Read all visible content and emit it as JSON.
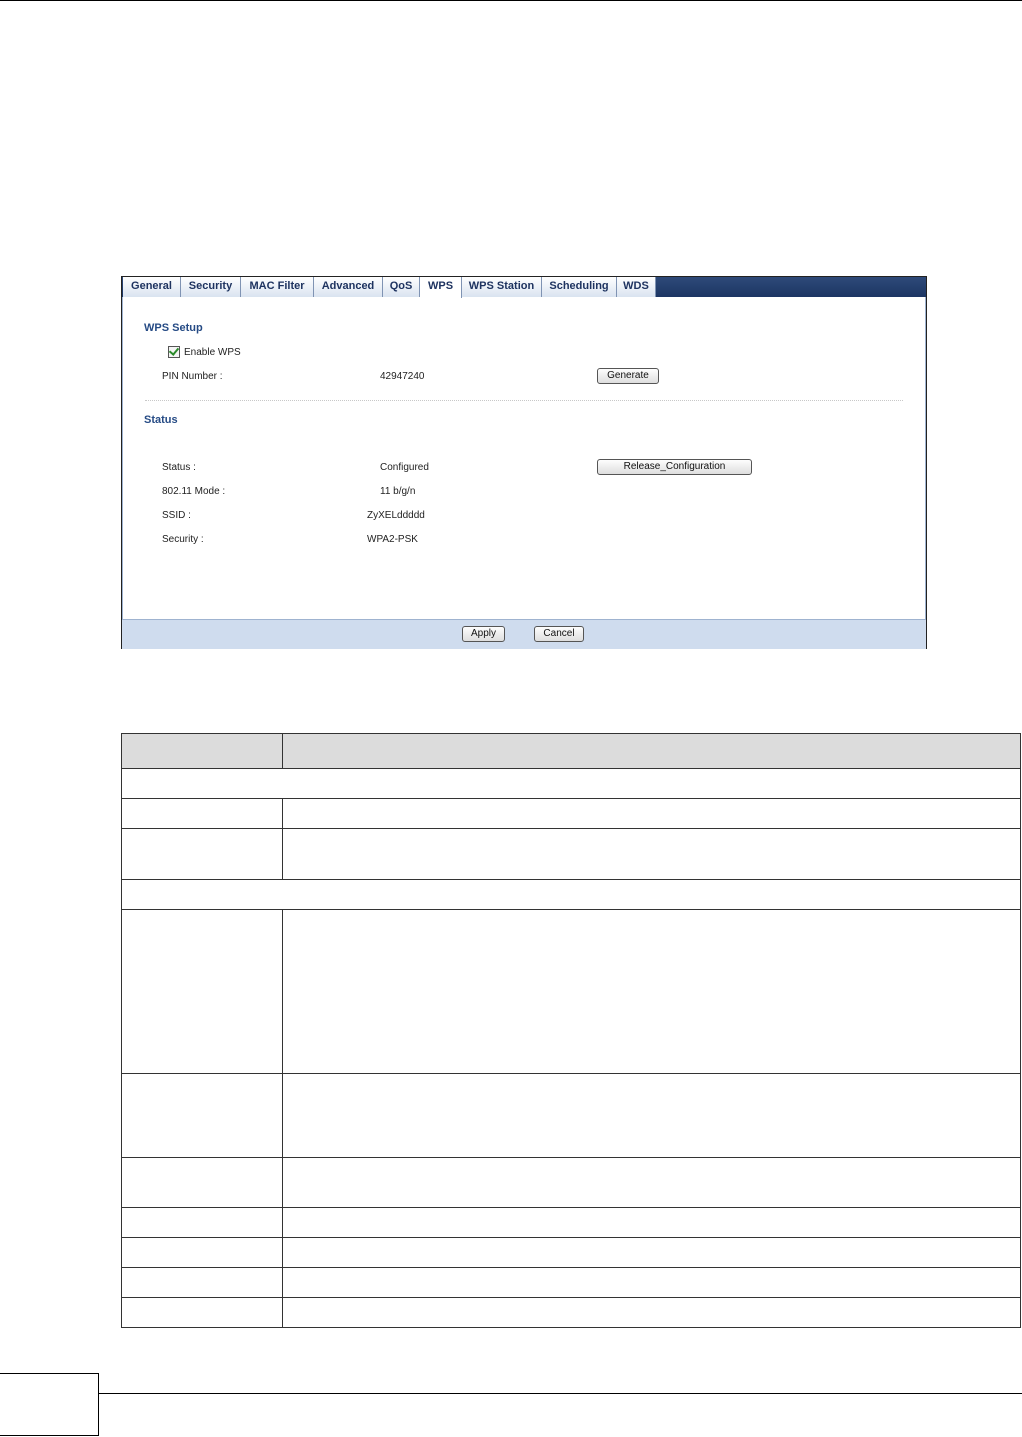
{
  "tabs": [
    {
      "label": "General",
      "active": false
    },
    {
      "label": "Security",
      "active": false
    },
    {
      "label": "MAC Filter",
      "active": false
    },
    {
      "label": "Advanced",
      "active": false
    },
    {
      "label": "QoS",
      "active": false
    },
    {
      "label": "WPS",
      "active": true
    },
    {
      "label": "WPS Station",
      "active": false
    },
    {
      "label": "Scheduling",
      "active": false
    },
    {
      "label": "WDS",
      "active": false
    }
  ],
  "wps_setup": {
    "title": "WPS Setup",
    "enable_label": "Enable WPS",
    "enabled": true,
    "pin_label": "PIN Number :",
    "pin_value": "42947240",
    "generate_button": "Generate"
  },
  "status": {
    "title": "Status",
    "status_label": "Status :",
    "status_value": "Configured",
    "release_button": "Release_Configuration",
    "mode_label": "802.11 Mode :",
    "mode_value": "11 b/g/n",
    "ssid_label": "SSID :",
    "ssid_value": "ZyXELddddd",
    "security_label": "Security :",
    "security_value": "WPA2-PSK"
  },
  "footer": {
    "apply_button": "Apply",
    "cancel_button": "Cancel"
  },
  "colors": {
    "tabbar": "#1c3563",
    "section_title": "#264b85",
    "footer_bar": "#cfdcee",
    "table_header": "#dcdcdc"
  }
}
